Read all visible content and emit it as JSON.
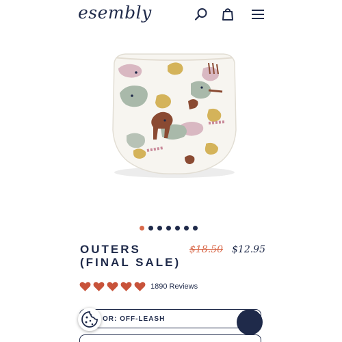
{
  "header": {
    "logo_text": "esembly",
    "icons": [
      "search-icon",
      "bag-icon",
      "menu-icon"
    ]
  },
  "product": {
    "title_line1": "OUTERS",
    "title_line2": "(FINAL SALE)",
    "price_original": "$18.50",
    "price_sale": "$12.95",
    "rating_stars": 5,
    "rating_max": 5,
    "reviews_text": "1890 Reviews",
    "image_count": 7,
    "active_image_index": 0
  },
  "options": {
    "color_label": "OR: OFF-LEASH",
    "caret": "▼"
  },
  "colors": {
    "navy": "#1f2a4a",
    "accent": "#d9694a",
    "heart": "#c8533a"
  }
}
